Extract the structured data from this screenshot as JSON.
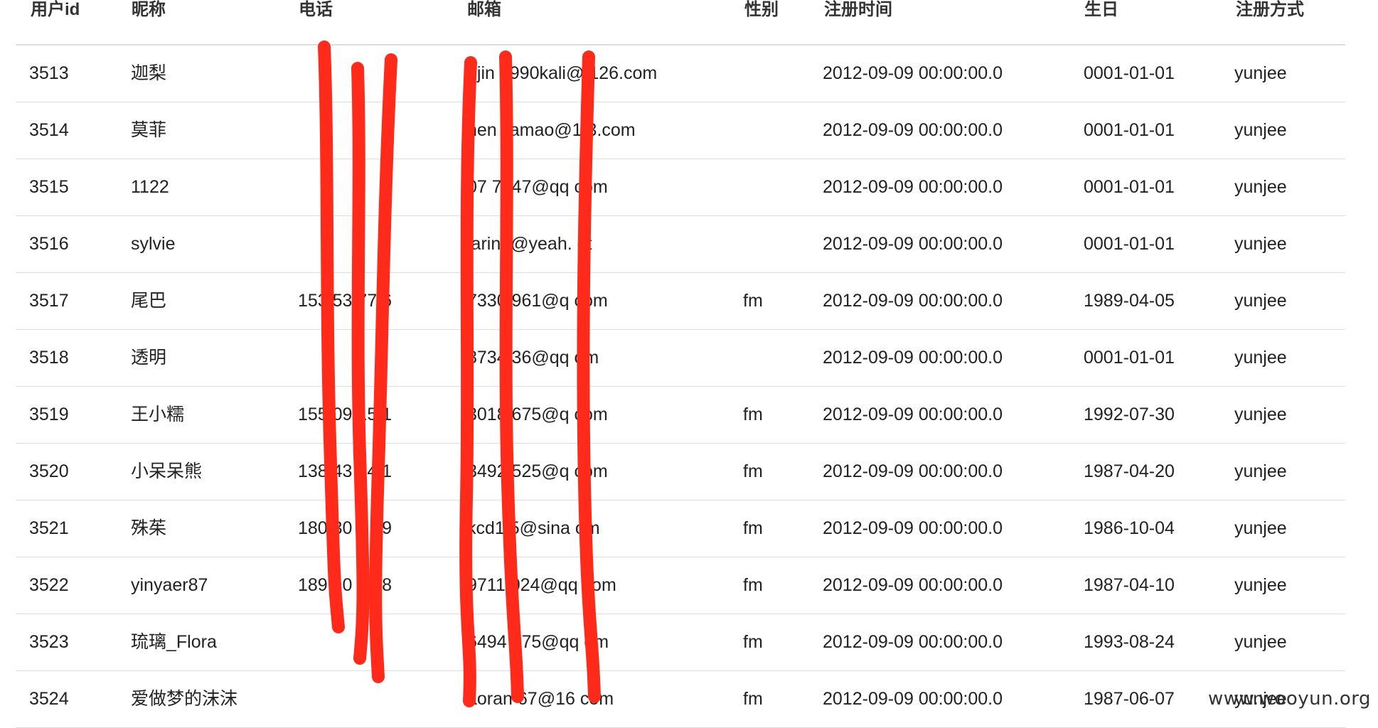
{
  "table": {
    "headers": [
      "用户id",
      "昵称",
      "电话",
      "邮箱",
      "性别",
      "注册时间",
      "生日",
      "注册方式"
    ],
    "rows": [
      [
        "3513",
        "迦梨",
        "",
        "ujin 1990kali@ 126.com",
        "",
        "2012-09-09 00:00:00.0",
        "0001-01-01",
        "yunjee"
      ],
      [
        "3514",
        "莫菲",
        "",
        "hen jiamao@1 3.com",
        "",
        "2012-09-09 00:00:00.0",
        "0001-01-01",
        "yunjee"
      ],
      [
        "3515",
        "1122",
        "",
        "07 7447@qq com",
        "",
        "2012-09-09 00:00:00.0",
        "0001-01-01",
        "yunjee"
      ],
      [
        "3516",
        "sylvie",
        "",
        "larin t@yeah. et",
        "",
        "2012-09-09 00:00:00.0",
        "0001-01-01",
        "yunjee"
      ],
      [
        "3517",
        "尾巴",
        "153 53 77 6",
        "7330 961@q com",
        "fm",
        "2012-09-09 00:00:00.0",
        "1989-04-05",
        "yunjee"
      ],
      [
        "3518",
        "透明",
        "",
        "8734 36@qq om",
        "",
        "2012-09-09 00:00:00.0",
        "0001-01-01",
        "yunjee"
      ],
      [
        "3519",
        "王小糯",
        "155 09 15 1",
        "3018 675@q com",
        "fm",
        "2012-09-09 00:00:00.0",
        "1992-07-30",
        "yunjee"
      ],
      [
        "3520",
        "小呆呆熊",
        "138 43 34 1",
        "3492 525@q com",
        "fm",
        "2012-09-09 00:00:00.0",
        "1987-04-20",
        "yunjee"
      ],
      [
        "3521",
        "殊茱",
        "180 30 2 49",
        "kcd1 5@sina om",
        "fm",
        "2012-09-09 00:00:00.0",
        "1986-10-04",
        "yunjee"
      ],
      [
        "3522",
        "yinyaer87",
        "1897 0 6 08",
        "9711 024@qq com",
        "fm",
        "2012-09-09 00:00:00.0",
        "1987-04-10",
        "yunjee"
      ],
      [
        "3523",
        "琉璃_Flora",
        "",
        "6494 875@qq om",
        "fm",
        "2012-09-09 00:00:00.0",
        "1993-08-24",
        "yunjee"
      ],
      [
        "3524",
        "爱做梦的沫沫",
        "",
        "aoran 67@16 com",
        "fm",
        "2012-09-09 00:00:00.0",
        "1987-06-07",
        "yunjee"
      ]
    ]
  },
  "redaction": {
    "color": "#ff2a1a",
    "label": "red marker redaction strokes"
  },
  "watermark": {
    "text": "www.wooyun.org"
  }
}
